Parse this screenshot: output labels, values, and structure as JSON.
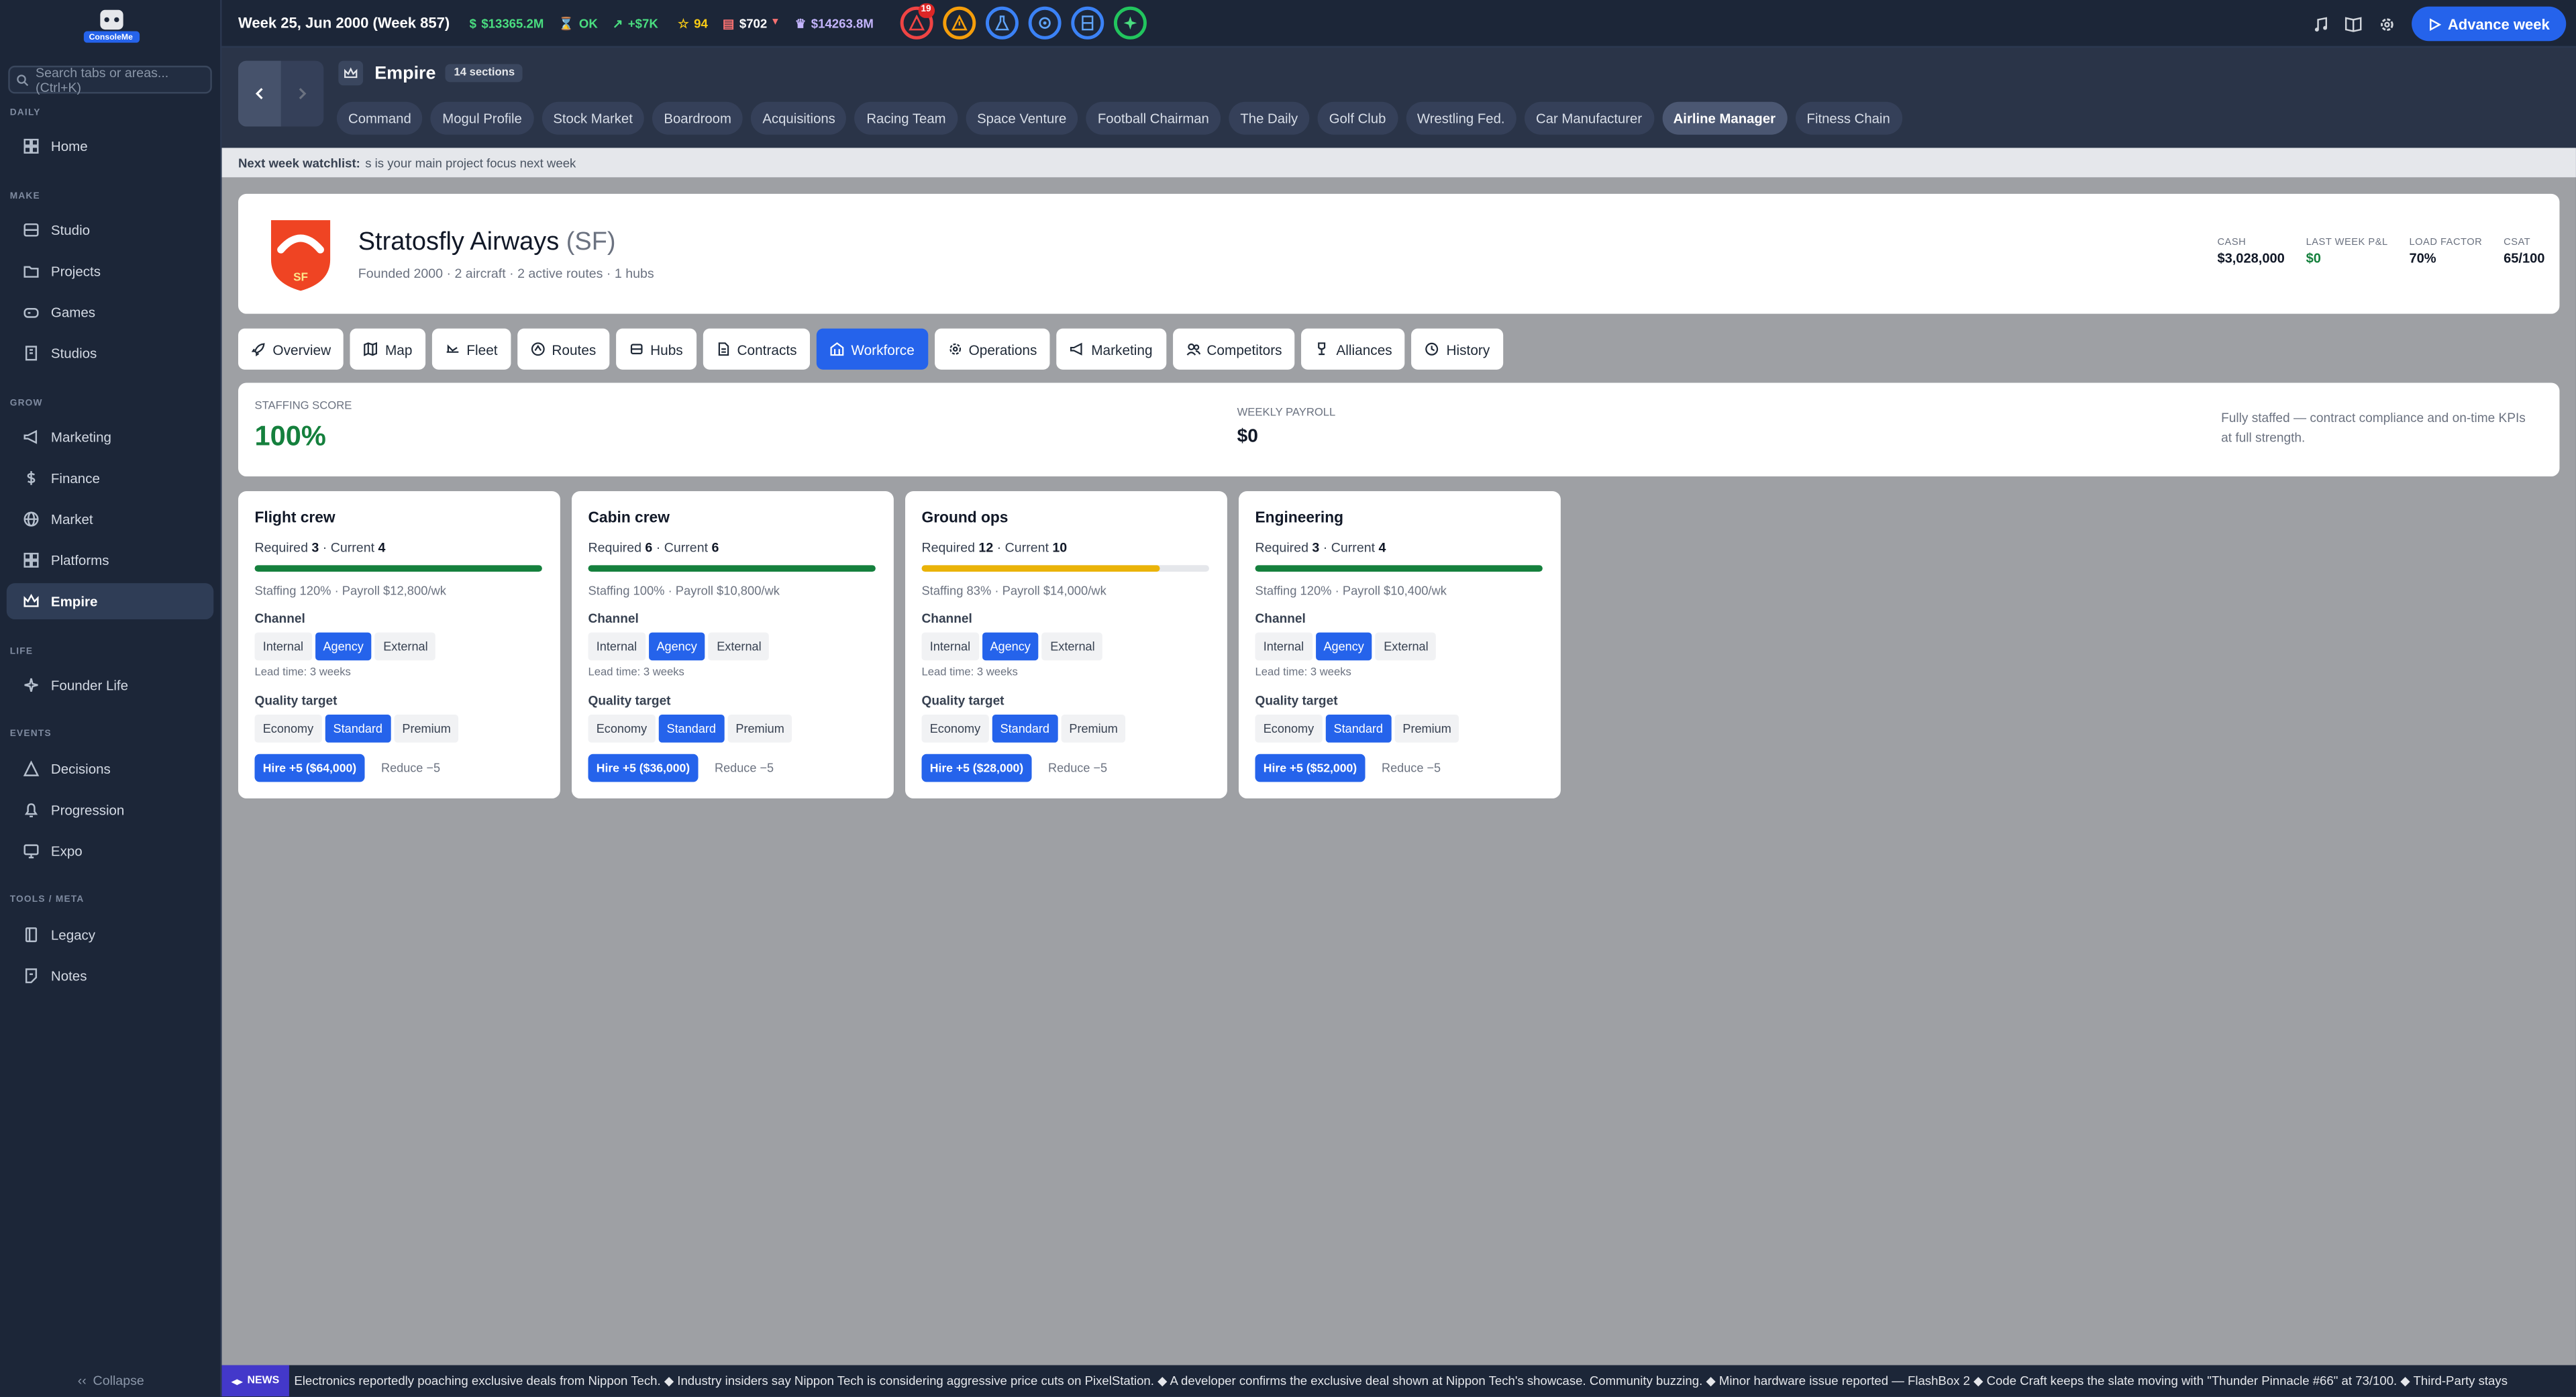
{
  "app": {
    "logo_text": "ConsoleMe"
  },
  "search": {
    "placeholder": "Search tabs or areas... (Ctrl+K)"
  },
  "sidebar": {
    "sections": [
      {
        "label": "DAILY",
        "items": [
          {
            "label": "Home",
            "icon": "grid-icon"
          }
        ]
      },
      {
        "label": "MAKE",
        "items": [
          {
            "label": "Studio",
            "icon": "film-icon"
          },
          {
            "label": "Projects",
            "icon": "folder-icon"
          },
          {
            "label": "Games",
            "icon": "gamepad-icon"
          },
          {
            "label": "Studios",
            "icon": "building-icon"
          }
        ]
      },
      {
        "label": "GROW",
        "items": [
          {
            "label": "Marketing",
            "icon": "megaphone-icon"
          },
          {
            "label": "Finance",
            "icon": "dollar-icon"
          },
          {
            "label": "Market",
            "icon": "globe-icon"
          },
          {
            "label": "Platforms",
            "icon": "grid-icon"
          },
          {
            "label": "Empire",
            "icon": "crown-icon",
            "active": true
          }
        ]
      },
      {
        "label": "LIFE",
        "items": [
          {
            "label": "Founder Life",
            "icon": "sparkles-icon"
          }
        ]
      },
      {
        "label": "EVENTS",
        "items": [
          {
            "label": "Decisions",
            "icon": "triangle-icon"
          },
          {
            "label": "Progression",
            "icon": "bell-icon"
          },
          {
            "label": "Expo",
            "icon": "monitor-icon"
          }
        ]
      },
      {
        "label": "TOOLS / META",
        "items": [
          {
            "label": "Legacy",
            "icon": "book-icon"
          },
          {
            "label": "Notes",
            "icon": "note-icon"
          }
        ]
      }
    ],
    "collapse_label": "Collapse"
  },
  "topbar": {
    "week": "Week 25, Jun 2000 (Week 857)",
    "cash": "$13365.2M",
    "status": "OK",
    "trend": "+$7K",
    "stars": "94",
    "price": "$702",
    "valuation": "$14263.8M",
    "alert_badge": "19",
    "advance_label": "Advance week"
  },
  "header": {
    "title": "Empire",
    "sections_badge": "14 sections",
    "tabs": [
      "Command",
      "Mogul Profile",
      "Stock Market",
      "Boardroom",
      "Acquisitions",
      "Racing Team",
      "Space Venture",
      "Football Chairman",
      "The Daily",
      "Golf Club",
      "Wrestling Fed.",
      "Car Manufacturer",
      "Airline Manager",
      "Fitness Chain"
    ],
    "active_tab": "Airline Manager"
  },
  "watchlist": {
    "label": "Next week watchlist:",
    "text": "s is your main project focus next week"
  },
  "airline": {
    "crest_initials": "SF",
    "name": "Stratosfly Airways",
    "code": "(SF)",
    "subtitle": "Founded 2000 · 2 aircraft · 2 active routes · 1 hubs",
    "kpis": [
      {
        "label": "CASH",
        "value": "$3,028,000",
        "color": "#111827"
      },
      {
        "label": "LAST WEEK P&L",
        "value": "$0",
        "color": "#15803d"
      },
      {
        "label": "LOAD FACTOR",
        "value": "70%",
        "color": "#111827"
      },
      {
        "label": "CSAT",
        "value": "65/100",
        "color": "#111827"
      }
    ],
    "brand_color": "#ef4423"
  },
  "subtabs": [
    {
      "label": "Overview",
      "icon": "rocket-icon"
    },
    {
      "label": "Map",
      "icon": "map-icon"
    },
    {
      "label": "Fleet",
      "icon": "plane-icon"
    },
    {
      "label": "Routes",
      "icon": "route-icon"
    },
    {
      "label": "Hubs",
      "icon": "hub-icon"
    },
    {
      "label": "Contracts",
      "icon": "document-icon"
    },
    {
      "label": "Workforce",
      "icon": "workforce-icon",
      "active": true
    },
    {
      "label": "Operations",
      "icon": "gear-icon"
    },
    {
      "label": "Marketing",
      "icon": "megaphone-icon"
    },
    {
      "label": "Competitors",
      "icon": "users-icon"
    },
    {
      "label": "Alliances",
      "icon": "trophy-icon"
    },
    {
      "label": "History",
      "icon": "history-icon"
    }
  ],
  "staffing": {
    "score_label": "STAFFING SCORE",
    "score": "100%",
    "payroll_label": "WEEKLY PAYROLL",
    "payroll": "$0",
    "note": "Fully staffed — contract compliance and on-time KPIs at full strength."
  },
  "crew_cards": [
    {
      "title": "Flight crew",
      "required": "3",
      "current": "4",
      "fill": 1.0,
      "bar_color": "#15803d",
      "info": "Staffing 120% · Payroll $12,800/wk",
      "channel": "Agency",
      "lead": "Lead time: 3 weeks",
      "quality": "Standard",
      "hire": "Hire +5 ($64,000)",
      "reduce": "Reduce −5"
    },
    {
      "title": "Cabin crew",
      "required": "6",
      "current": "6",
      "fill": 1.0,
      "bar_color": "#15803d",
      "info": "Staffing 100% · Payroll $10,800/wk",
      "channel": "Agency",
      "lead": "Lead time: 3 weeks",
      "quality": "Standard",
      "hire": "Hire +5 ($36,000)",
      "reduce": "Reduce −5"
    },
    {
      "title": "Ground ops",
      "required": "12",
      "current": "10",
      "fill": 0.83,
      "bar_color": "#eab308",
      "info": "Staffing 83% · Payroll $14,000/wk",
      "channel": "Agency",
      "lead": "Lead time: 3 weeks",
      "quality": "Standard",
      "hire": "Hire +5 ($28,000)",
      "reduce": "Reduce −5"
    },
    {
      "title": "Engineering",
      "required": "3",
      "current": "4",
      "fill": 1.0,
      "bar_color": "#15803d",
      "info": "Staffing 120% · Payroll $10,400/wk",
      "channel": "Agency",
      "lead": "Lead time: 3 weeks",
      "quality": "Standard",
      "hire": "Hire +5 ($52,000)",
      "reduce": "Reduce −5"
    }
  ],
  "labels": {
    "required": "Required",
    "current": "Current",
    "channel": "Channel",
    "quality": "Quality target"
  },
  "channel_options": [
    "Internal",
    "Agency",
    "External"
  ],
  "quality_options": [
    "Economy",
    "Standard",
    "Premium"
  ],
  "news": {
    "badge": "NEWS",
    "text": "Electronics reportedly poaching exclusive deals from Nippon Tech. ◆ Industry insiders say Nippon Tech is considering aggressive price cuts on PixelStation. ◆ A developer confirms the exclusive deal shown at Nippon Tech's showcase. Community buzzing. ◆ Minor hardware issue reported — FlashBox 2 ◆ Code Craft keeps the slate moving with \"Thunder Pinnacle #66\" at 73/100. ◆ Third-Party stays"
  }
}
